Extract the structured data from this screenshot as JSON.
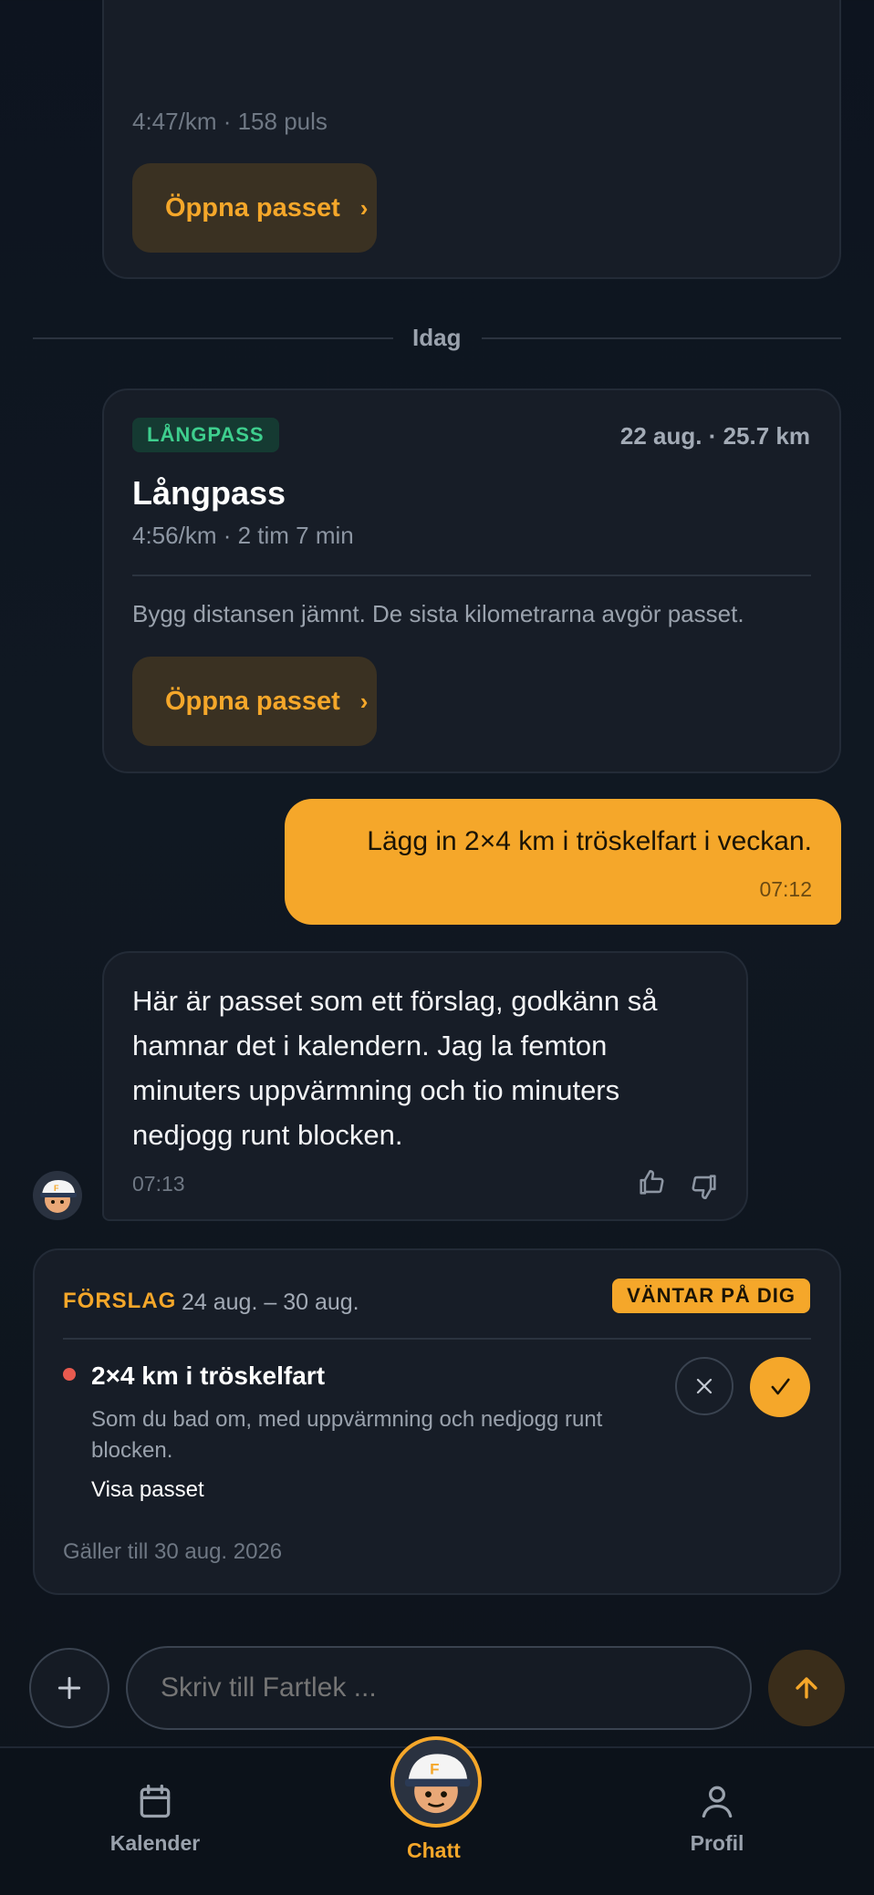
{
  "prev_card": {
    "stats": "4:47/km · 158 puls",
    "button_label": "Öppna passet"
  },
  "day_divider": "Idag",
  "workout_card": {
    "tag": "LÅNGPASS",
    "date_distance": "22 aug. · 25.7 km",
    "title": "Långpass",
    "stats": "4:56/km · 2 tim 7 min",
    "description": "Bygg distansen jämnt. De sista kilometrarna avgör passet.",
    "button_label": "Öppna passet"
  },
  "user_message": {
    "text": "Lägg in 2×4 km i tröskelfart i veckan.",
    "time": "07:12"
  },
  "coach_message": {
    "lines": [
      "Här är passet som ett förslag, godkänn så",
      "hamnar det i kalendern. Jag la femton",
      "minuters uppvärmning och tio minuters",
      "nedjogg runt blocken."
    ],
    "time": "07:13"
  },
  "proposal": {
    "label": "FÖRSLAG",
    "period": "24 aug. – 30 aug.",
    "status_badge": "VÄNTAR PÅ DIG",
    "item_title": "2×4 km i tröskelfart",
    "item_desc_lines": [
      "Som du bad om, med uppvärmning och nedjogg runt",
      "blocken."
    ],
    "view_link": "Visa passet",
    "valid_until": "Gäller till 30 aug. 2026"
  },
  "composer": {
    "placeholder": "Skriv till Fartlek ..."
  },
  "bottom_nav": {
    "calendar": "Kalender",
    "chat": "Chatt",
    "profile": "Profil"
  },
  "colors": {
    "accent": "#f5a72a",
    "green_tag": "#3ecf8e",
    "red_dot": "#e85a4f"
  },
  "icons": {
    "chevron": "chevron-right-icon",
    "thumbs_up": "thumbs-up-icon",
    "thumbs_down": "thumbs-down-icon",
    "close": "close-icon",
    "check": "check-icon",
    "plus": "plus-icon",
    "send": "arrow-up-icon",
    "calendar": "calendar-icon",
    "profile": "person-icon"
  }
}
